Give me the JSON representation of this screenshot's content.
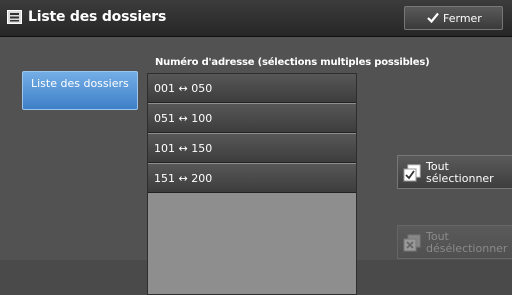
{
  "window": {
    "title": "Liste des dossiers",
    "close_label": "Fermer"
  },
  "sidebar": {
    "tab_label": "Liste des dossiers"
  },
  "list": {
    "header": "Numéro d'adresse (sélections multiples possibles)",
    "rows": [
      {
        "label": "001 ↔ 050"
      },
      {
        "label": "051 ↔ 100"
      },
      {
        "label": "101 ↔ 150"
      },
      {
        "label": "151 ↔ 200"
      }
    ]
  },
  "actions": {
    "select_all_line1": "Tout",
    "select_all_line2": "sélectionner",
    "deselect_all_line1": "Tout",
    "deselect_all_line2": "désélectionner"
  },
  "colors": {
    "active_tab": "#4a90d9",
    "title_bar": "#2e2e2e"
  },
  "icons": {
    "title": "folder-list-icon",
    "close": "checkmark-icon",
    "select_all": "select-all-icon",
    "deselect_all": "deselect-all-icon"
  }
}
